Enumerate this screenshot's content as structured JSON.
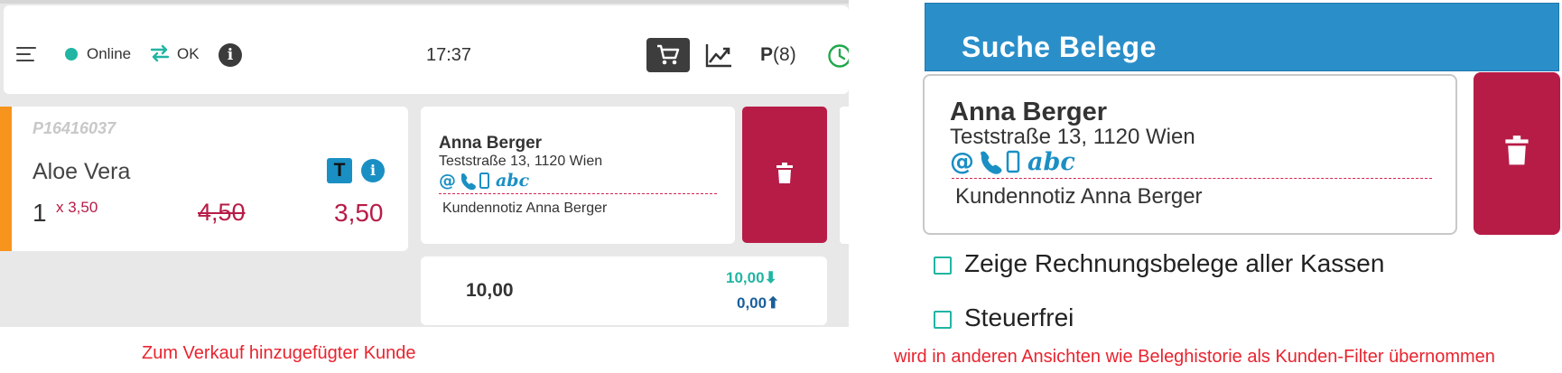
{
  "pos_view": {
    "topbar": {
      "status_online": "Online",
      "status_sync": "OK",
      "time": "17:37",
      "parked_label": "P",
      "parked_count": "(8)"
    },
    "article": {
      "code": "P16416037",
      "name": "Aloe Vera",
      "quantity": "1",
      "unit_price": "x 3,50",
      "original_price": "4,50",
      "price": "3,50",
      "badge": "T"
    },
    "customer": {
      "name": "Anna Berger",
      "address": "Teststraße 13, 1120 Wien",
      "contact_text": "abc",
      "note": "Kundennotiz Anna Berger"
    },
    "totals": {
      "total": "10,00",
      "received": "10,00",
      "change": "0,00"
    },
    "caption": "Zum Verkauf hinzugefügter Kunde"
  },
  "search_view": {
    "title": "Suche Belege",
    "customer": {
      "name": "Anna Berger",
      "address": "Teststraße 13, 1120 Wien",
      "contact_text": "abc",
      "note": "Kundennotiz Anna Berger"
    },
    "options": [
      {
        "label": "Zeige Rechnungsbelege aller Kassen",
        "checked": false
      },
      {
        "label": "Steuerfrei",
        "checked": false
      }
    ],
    "caption": "wird in anderen Ansichten wie Beleghistorie als Kunden-Filter übernommen"
  },
  "colors": {
    "accent_red": "#b71c47",
    "teal": "#21b5a3",
    "blue": "#2a8fc9",
    "orange": "#f7941d",
    "caption_red": "#e8242f"
  }
}
